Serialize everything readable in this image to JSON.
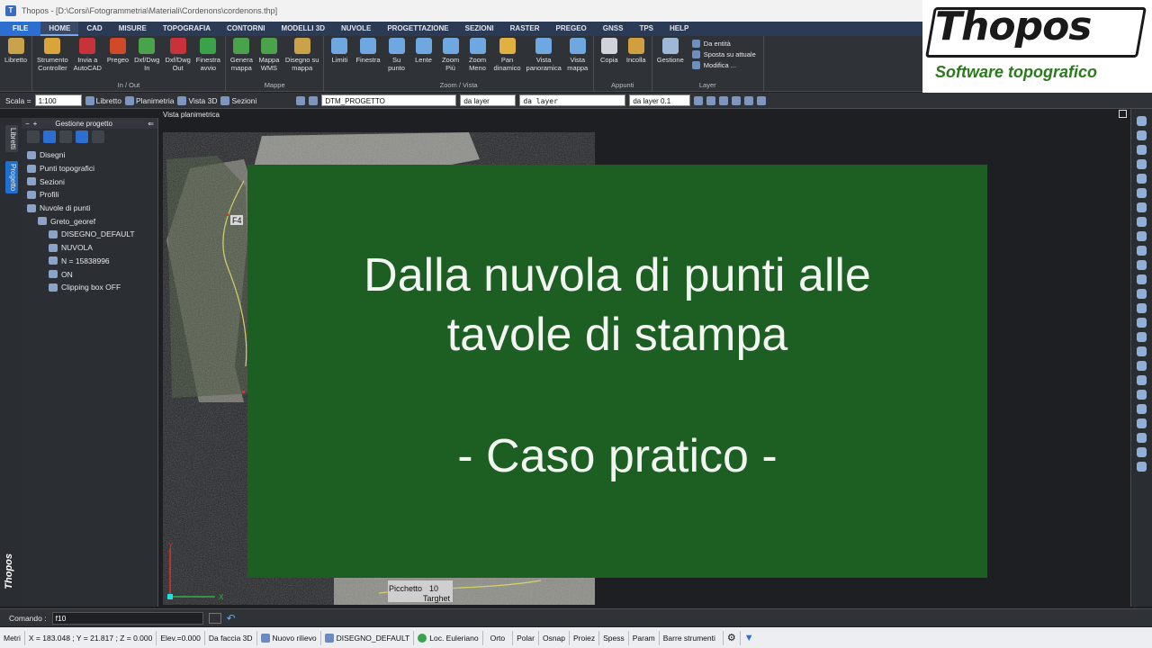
{
  "window": {
    "title": "Thopos - [D:\\Corsi\\Fotogrammetria\\Materiali\\Cordenons\\cordenons.thp]"
  },
  "menu": [
    "FILE",
    "HOME",
    "CAD",
    "MISURE",
    "TOPOGRAFIA",
    "CONTORNI",
    "MODELLI 3D",
    "NUVOLE",
    "PROGETTAZIONE",
    "SEZIONI",
    "RASTER",
    "PREGEO",
    "GNSS",
    "TPS",
    "HELP"
  ],
  "ribbon": {
    "groups": [
      {
        "label": "",
        "buttons": [
          {
            "label": "Libretto",
            "icon": "notebook-icon",
            "color": "#c9a24a"
          }
        ]
      },
      {
        "label": "In / Out",
        "buttons": [
          {
            "label": "Strumento\nController",
            "icon": "controller-icon",
            "color": "#d9a53a"
          },
          {
            "label": "Invia a\nAutoCAD",
            "icon": "autocad-icon",
            "color": "#c8323a"
          },
          {
            "label": "Pregeo",
            "icon": "pregeo-icon",
            "color": "#d04a2a"
          },
          {
            "label": "Dxf/Dwg\nIn",
            "icon": "dwg-in-icon",
            "color": "#4aa34a"
          },
          {
            "label": "Dxf/Dwg\nOut",
            "icon": "dwg-out-icon",
            "color": "#c8323a"
          },
          {
            "label": "Finestra\navvio",
            "icon": "play-window-icon",
            "color": "#3aa34a"
          }
        ]
      },
      {
        "label": "Mappe",
        "buttons": [
          {
            "label": "Genera\nmappa",
            "icon": "generate-map-icon",
            "color": "#4aa34a"
          },
          {
            "label": "Mappa\nWMS",
            "icon": "wms-map-icon",
            "color": "#4aa34a"
          },
          {
            "label": "Disegno su\nmappa",
            "icon": "draw-on-map-icon",
            "color": "#c9a24a"
          }
        ]
      },
      {
        "label": "Zoom / Vista",
        "buttons": [
          {
            "label": "Limiti",
            "icon": "zoom-limits-icon",
            "color": "#6fa8e0"
          },
          {
            "label": "Finestra",
            "icon": "zoom-window-icon",
            "color": "#6fa8e0"
          },
          {
            "label": "Su\npunto",
            "icon": "zoom-point-icon",
            "color": "#6fa8e0"
          },
          {
            "label": "Lente",
            "icon": "magnifier-icon",
            "color": "#6fa8e0"
          },
          {
            "label": "Zoom\nPiù",
            "icon": "zoom-in-icon",
            "color": "#6fa8e0"
          },
          {
            "label": "Zoom\nMeno",
            "icon": "zoom-out-icon",
            "color": "#6fa8e0"
          },
          {
            "label": "Pan\ndinamico",
            "icon": "hand-pan-icon",
            "color": "#e0b040"
          },
          {
            "label": "Vista\npanoramica",
            "icon": "panorama-icon",
            "color": "#6fa8e0"
          },
          {
            "label": "Vista\nmappa",
            "icon": "map-view-icon",
            "color": "#6fa8e0"
          }
        ]
      },
      {
        "label": "Appunti",
        "buttons": [
          {
            "label": "Copia",
            "icon": "copy-icon",
            "color": "#d0d4da"
          },
          {
            "label": "Incolla",
            "icon": "paste-icon",
            "color": "#d0a040"
          }
        ]
      },
      {
        "label": "Layer",
        "buttons": [
          {
            "label": "Gestione",
            "icon": "layers-icon",
            "color": "#a0b8d8"
          }
        ],
        "list": [
          "Da entità",
          "Sposta su attuale",
          "Modifica ..."
        ]
      }
    ]
  },
  "logo": {
    "brand": "Thopos",
    "tagline": "Software topografico"
  },
  "toolbar2": {
    "scale_label": "Scala =",
    "scale_value": "1:100",
    "views": [
      "Libretto",
      "Planimetria",
      "Vista 3D",
      "Sezioni"
    ],
    "layer": "DTM_PROGETTO",
    "color": "da layer",
    "linetype": "da layer",
    "lineweight": "da layer 0.1"
  },
  "sidetabs": [
    "Libretti",
    "Progetto"
  ],
  "side_brand": "Thopos",
  "panel": {
    "title": "Gestione progetto",
    "tree": [
      {
        "label": "Disegni",
        "indent": 0
      },
      {
        "label": "Punti topografici",
        "indent": 0
      },
      {
        "label": "Sezioni",
        "indent": 0
      },
      {
        "label": "Profili",
        "indent": 0
      },
      {
        "label": "Nuvole di punti",
        "indent": 0
      },
      {
        "label": "Greto_georef",
        "indent": 1
      },
      {
        "label": "DISEGNO_DEFAULT",
        "indent": 2
      },
      {
        "label": "NUVOLA",
        "indent": 2
      },
      {
        "label": "N = 15838996",
        "indent": 2
      },
      {
        "label": "ON",
        "indent": 2
      },
      {
        "label": "Clipping box OFF",
        "indent": 2
      }
    ]
  },
  "viewport": {
    "title": "Vista planimetrica",
    "labels": {
      "f4": "F4",
      "picchetto": "Picchetto",
      "ten": "10",
      "targhet": "Targhet"
    },
    "axis_y": "Y",
    "axis_x": "X"
  },
  "overlay": {
    "title_line1": "Dalla nuvola di punti alle",
    "title_line2": "tavole di stampa",
    "subtitle": "- Caso pratico -",
    "bg": "#1d5e22"
  },
  "command": {
    "label": "Comando :",
    "value": "f10"
  },
  "status": {
    "units": "Metri",
    "coords": "X = 183.048 ; Y = 21.817 ; Z = 0.000",
    "elev": "Elev.=0.000",
    "face": "Da faccia 3D",
    "survey": "Nuovo rilievo",
    "drawing": "DISEGNO_DEFAULT",
    "loc": "Loc. Euleriano",
    "toggles": [
      "Orto",
      "Polar",
      "Osnap",
      "Proiez",
      "Spess",
      "Param",
      "Barre strumenti"
    ]
  }
}
